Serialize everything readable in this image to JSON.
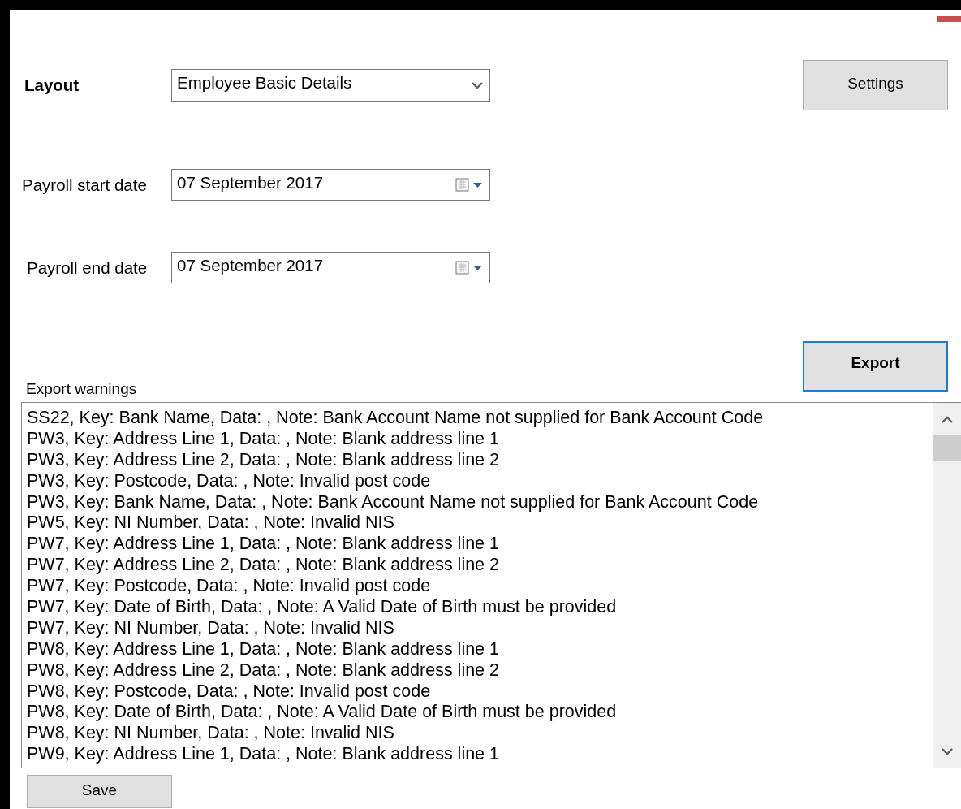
{
  "layout": {
    "label": "Layout",
    "value": "Employee Basic Details"
  },
  "settings_button": {
    "label": "Settings",
    "focused": false
  },
  "start_date": {
    "label": "Payroll start date",
    "value": "07 September 2017"
  },
  "end_date": {
    "label": "Payroll end date",
    "value": "07 September 2017"
  },
  "export_button": {
    "label": "Export",
    "focused": true
  },
  "export_warnings": {
    "label": "Export warnings",
    "lines": [
      "SS22, Key: Bank Name, Data: , Note: Bank Account Name not supplied for Bank Account Code",
      "PW3, Key: Address Line 1, Data: , Note: Blank address line 1",
      "PW3, Key: Address Line 2, Data: , Note: Blank address line 2",
      "PW3, Key: Postcode, Data: , Note: Invalid post code",
      "PW3, Key: Bank Name, Data: , Note: Bank Account Name not supplied for Bank Account Code",
      "PW5, Key: NI Number, Data: , Note: Invalid NIS",
      "PW7, Key: Address Line 1, Data: , Note: Blank address line 1",
      "PW7, Key: Address Line 2, Data: , Note: Blank address line 2",
      "PW7, Key: Postcode, Data: , Note: Invalid post code",
      "PW7, Key: Date of Birth, Data: , Note: A Valid Date of Birth must be provided",
      "PW7, Key: NI Number, Data: , Note: Invalid NIS",
      "PW8, Key: Address Line 1, Data: , Note: Blank address line 1",
      "PW8, Key: Address Line 2, Data: , Note: Blank address line 2",
      "PW8, Key: Postcode, Data: , Note: Invalid post code",
      "PW8, Key: Date of Birth, Data: , Note: A Valid Date of Birth must be provided",
      "PW8, Key: NI Number, Data: , Note: Invalid NIS",
      "PW9, Key: Address Line 1, Data: , Note: Blank address line 1"
    ]
  },
  "save_button": {
    "label": "Save",
    "focused": false
  }
}
